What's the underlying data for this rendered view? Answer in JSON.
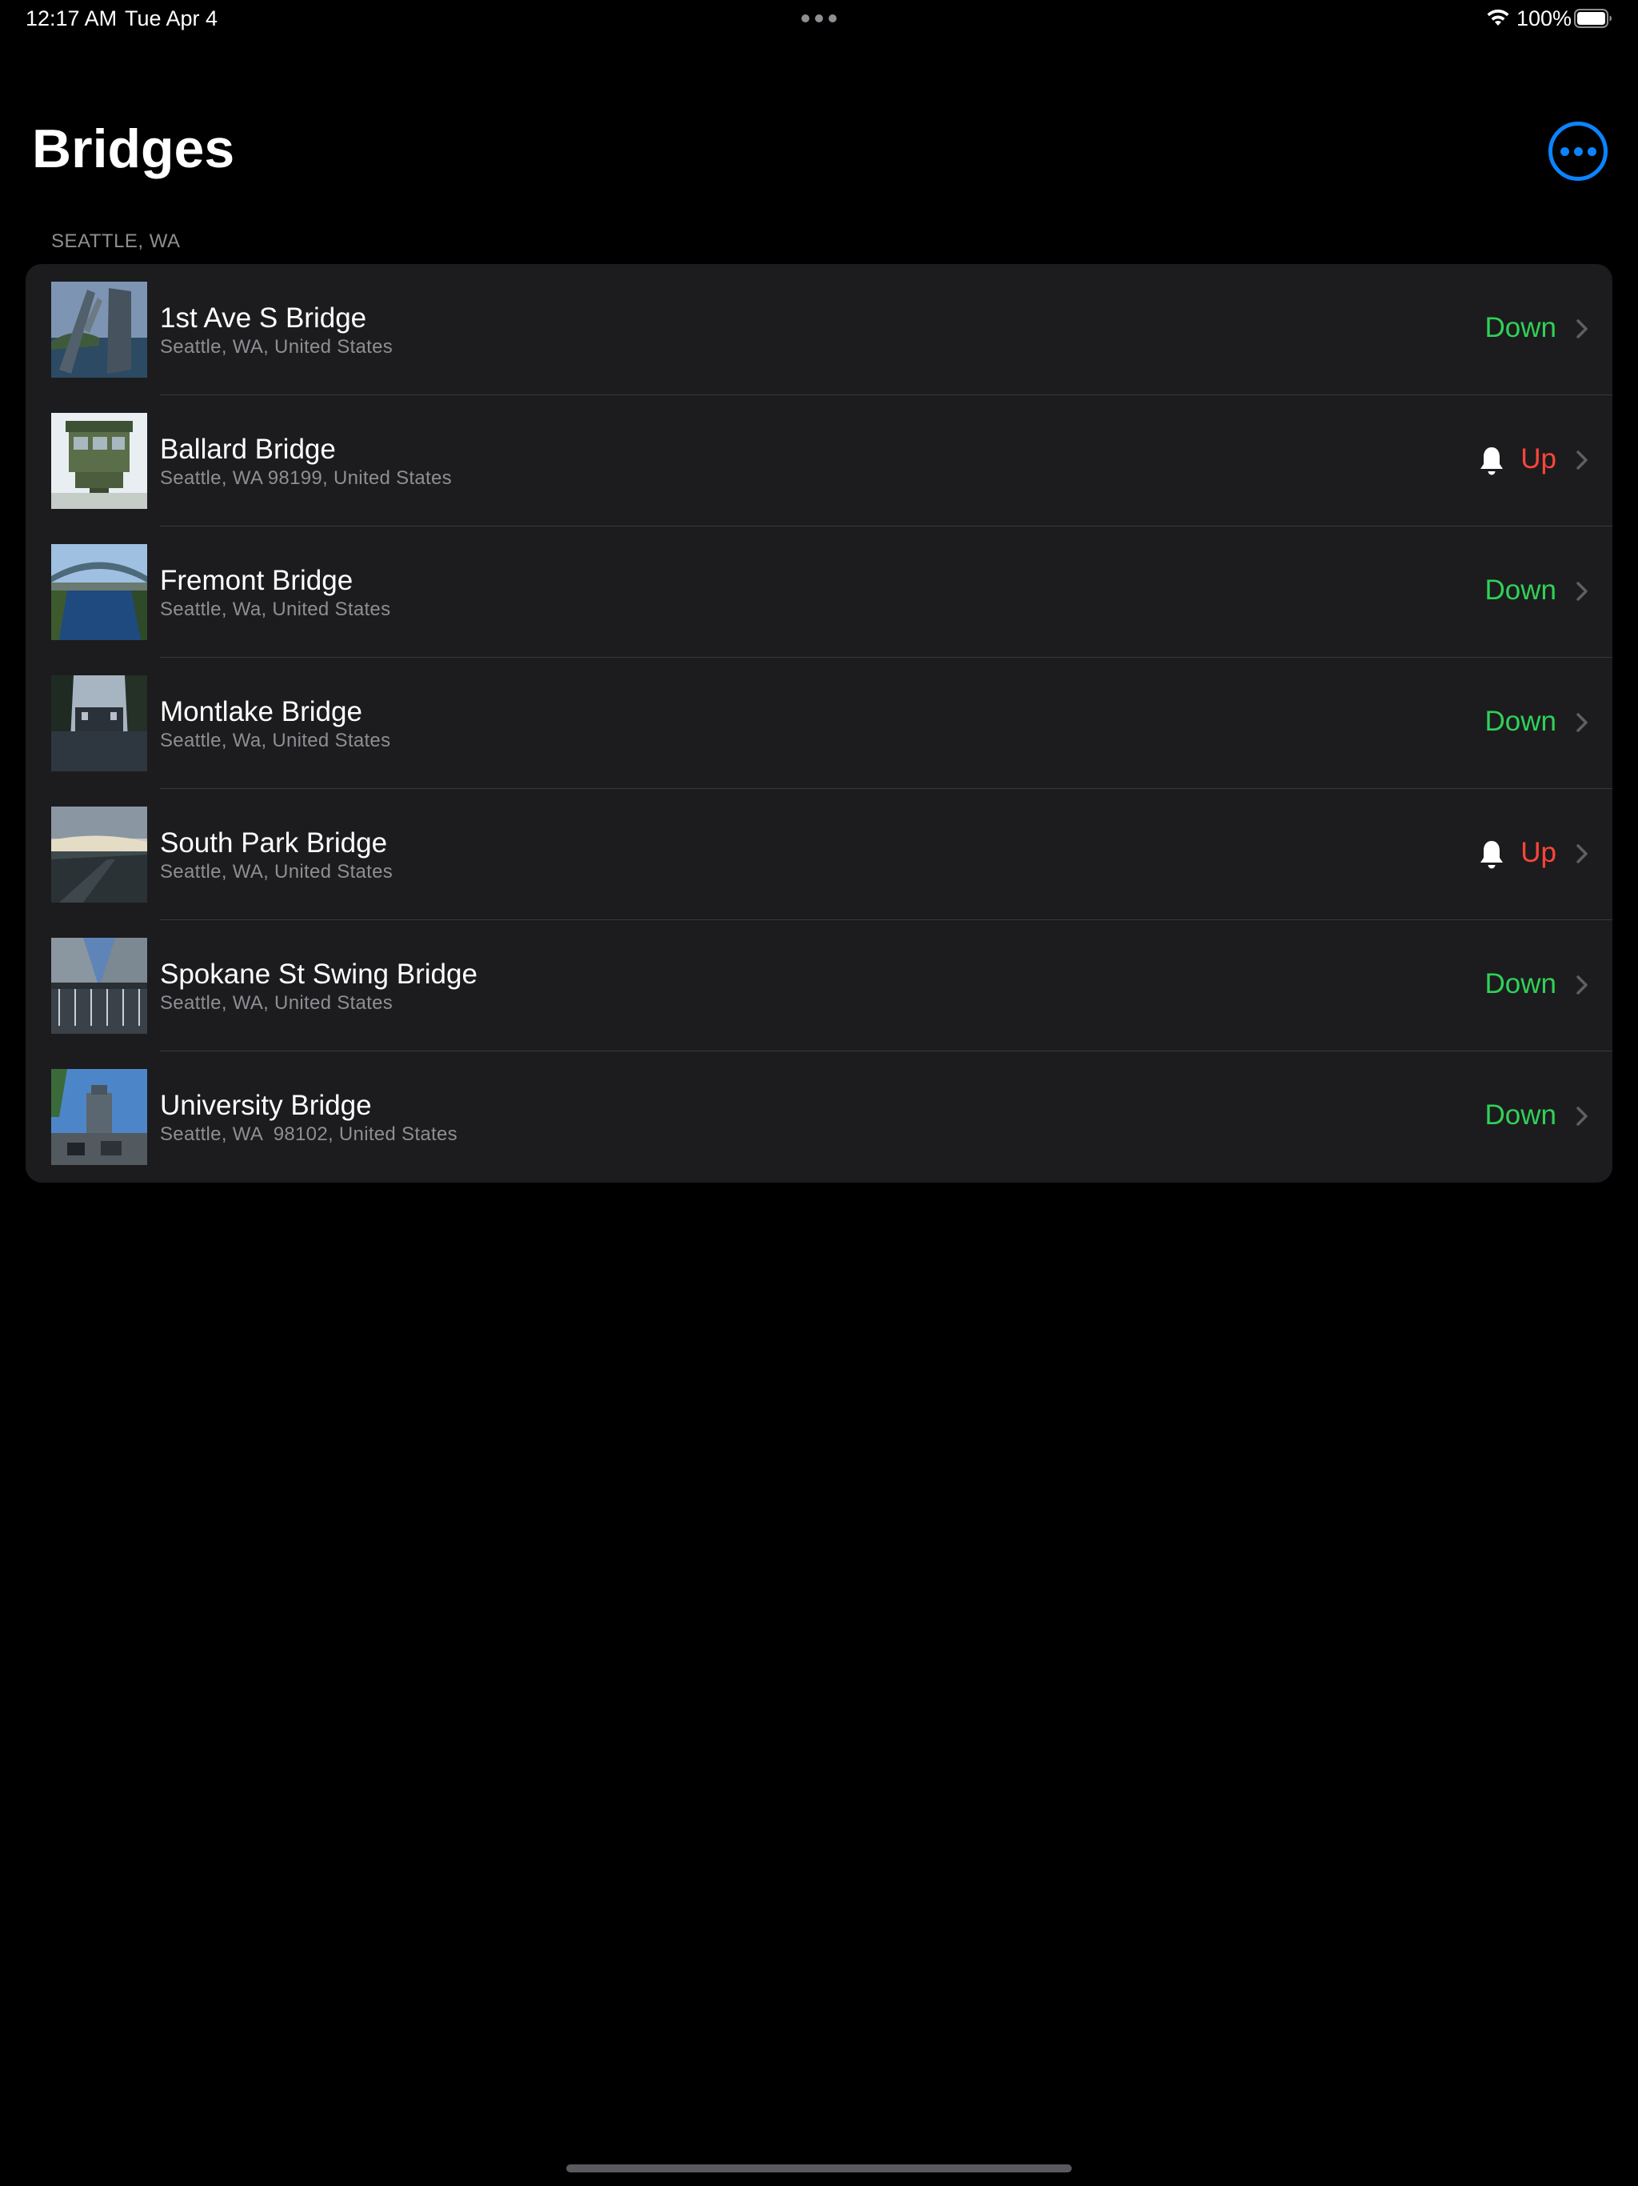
{
  "status_bar": {
    "time": "12:17 AM",
    "date": "Tue Apr 4",
    "battery": "100%"
  },
  "header": {
    "title": "Bridges",
    "more_icon": "ellipsis-circle-icon"
  },
  "section": {
    "title": "SEATTLE, WA"
  },
  "colors": {
    "accent": "#0a84ff",
    "status_down": "#30d158",
    "status_up": "#ff453a",
    "background": "#000000",
    "cell_background": "#1c1c1e"
  },
  "bridges": [
    {
      "name": "1st Ave S Bridge",
      "address": "Seattle, WA, United States",
      "status": "Down",
      "alert": false
    },
    {
      "name": "Ballard Bridge",
      "address": "Seattle, WA 98199, United States",
      "status": "Up",
      "alert": true
    },
    {
      "name": "Fremont Bridge",
      "address": "Seattle, Wa, United States",
      "status": "Down",
      "alert": false
    },
    {
      "name": "Montlake Bridge",
      "address": "Seattle, Wa, United States",
      "status": "Down",
      "alert": false
    },
    {
      "name": "South Park Bridge",
      "address": "Seattle, WA, United States",
      "status": "Up",
      "alert": true
    },
    {
      "name": "Spokane St Swing Bridge",
      "address": "Seattle, WA, United States",
      "status": "Down",
      "alert": false
    },
    {
      "name": "University Bridge",
      "address": "Seattle, WA  98102, United States",
      "status": "Down",
      "alert": false
    }
  ]
}
